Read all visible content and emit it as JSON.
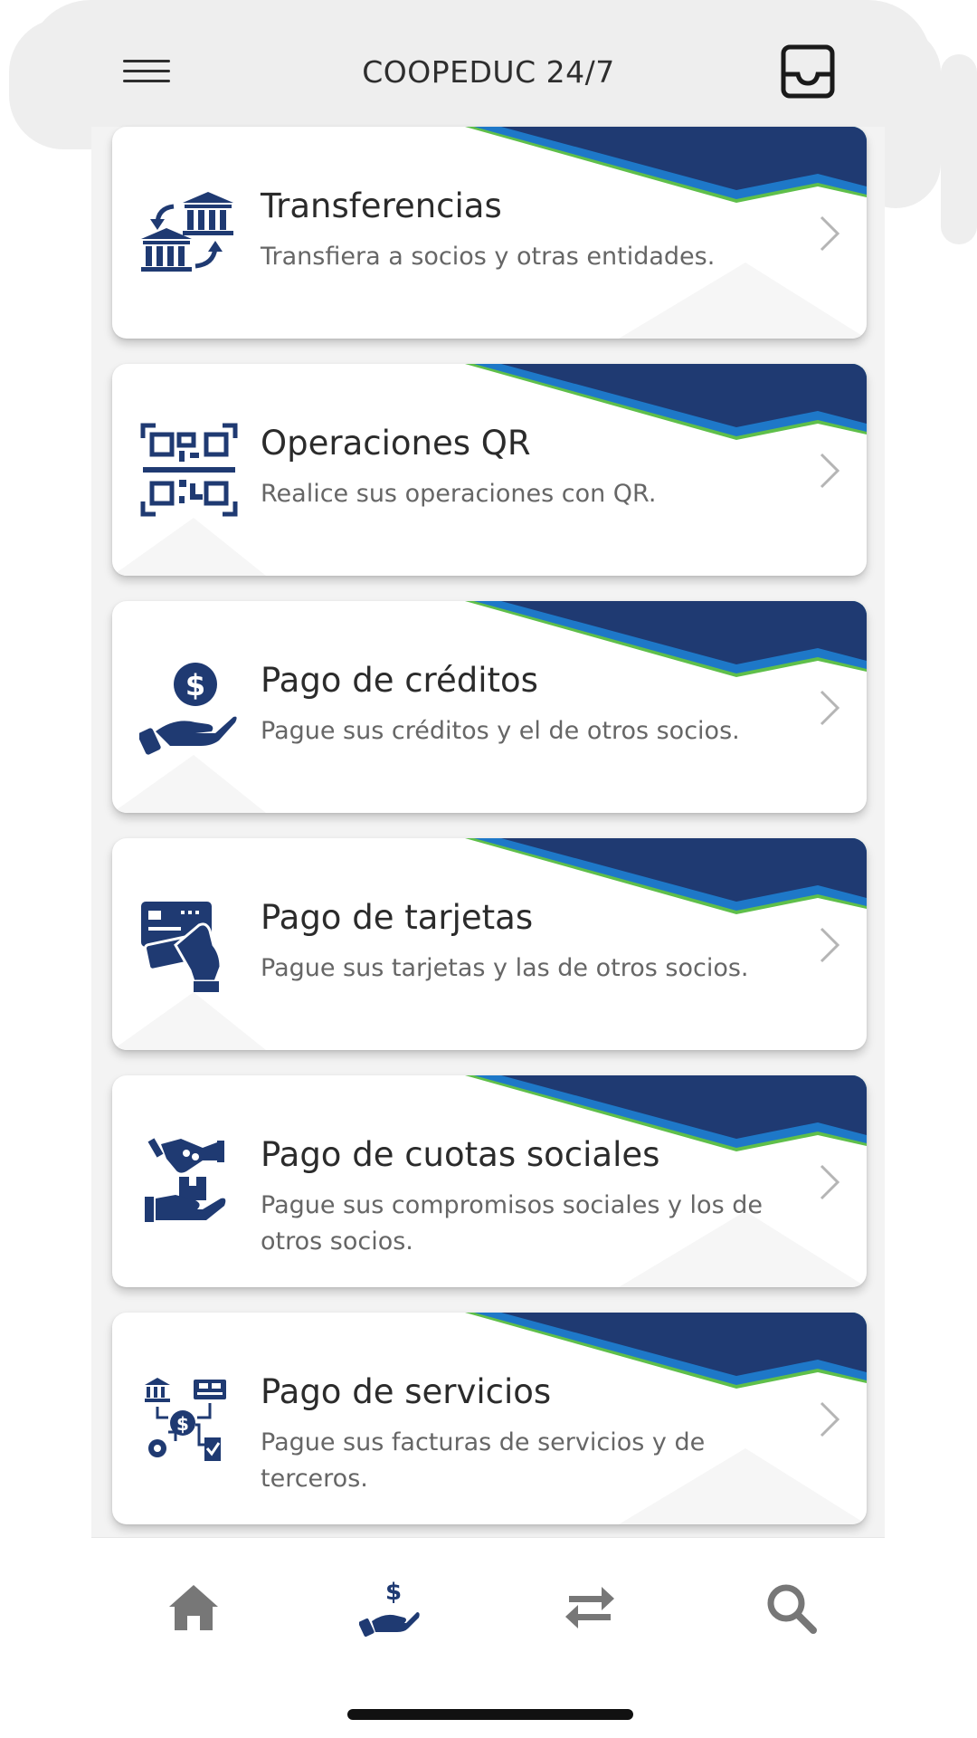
{
  "header": {
    "title": "COOPEDUC 24/7",
    "menu_icon": "hamburger-menu-icon",
    "inbox_icon": "inbox-icon"
  },
  "colors": {
    "banner_navy": "#1f3a72",
    "banner_blue": "#1e78c8",
    "banner_green": "#5fbf4a",
    "icon_navy": "#1f3a72",
    "nav_gray": "#777777"
  },
  "menu": {
    "items": [
      {
        "title": "Transferencias",
        "description": "Transfiera a socios y otras entidades.",
        "icon": "bank-transfer-icon"
      },
      {
        "title": "Operaciones QR",
        "description": "Realice sus operaciones con QR.",
        "icon": "qr-scan-icon"
      },
      {
        "title": "Pago de créditos",
        "description": "Pague sus créditos y el de otros socios.",
        "icon": "hand-coin-icon"
      },
      {
        "title": "Pago de tarjetas",
        "description": "Pague sus tarjetas y las de otros socios.",
        "icon": "card-payment-icon"
      },
      {
        "title": "Pago de cuotas sociales",
        "description": "Pague sus compromisos sociales y los de otros socios.",
        "icon": "handshake-box-icon"
      },
      {
        "title": "Pago de servicios",
        "description": "Pague sus facturas de servicios y de terceros.",
        "icon": "services-payment-icon"
      }
    ]
  },
  "bottom_nav": {
    "items": [
      {
        "icon": "home-icon",
        "active": false
      },
      {
        "icon": "hand-dollar-icon",
        "active": true
      },
      {
        "icon": "transfer-arrows-icon",
        "active": false
      },
      {
        "icon": "search-icon",
        "active": false
      }
    ]
  }
}
